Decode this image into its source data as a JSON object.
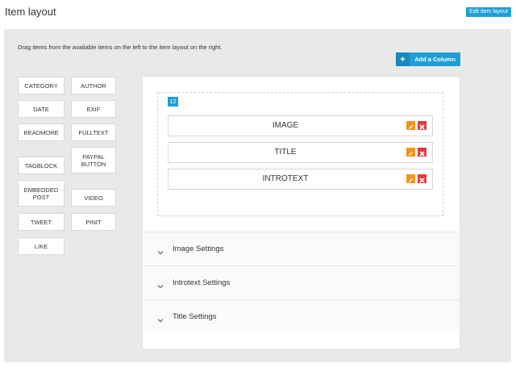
{
  "header": {
    "title": "Item layout",
    "edit_button": "Edit item layout"
  },
  "panel": {
    "instructions": "Drag items from the available items on the left to the item layout on the right.",
    "add_column_label": "Add a Column",
    "add_column_icon": "plus-icon"
  },
  "available_items": [
    "CATEGORY",
    "AUTHOR",
    "DATE",
    "EXIF",
    "READMORE",
    "FULLTEXT",
    "TAGBLOCK",
    "PAYPAL BUTTON",
    "EMBEDDED POST",
    "VIDEO",
    "TWEET",
    "PINIT",
    "LIKE"
  ],
  "layout": {
    "column_width": "12",
    "rows": [
      "IMAGE",
      "TITLE",
      "INTROTEXT"
    ]
  },
  "settings_sections": [
    "Image Settings",
    "Introtext Settings",
    "Title Settings"
  ],
  "colors": {
    "accent": "#1f9ed6",
    "edit_icon": "#f2941a",
    "delete_icon": "#e23b3b",
    "panel_bg": "#e9e9e9"
  }
}
